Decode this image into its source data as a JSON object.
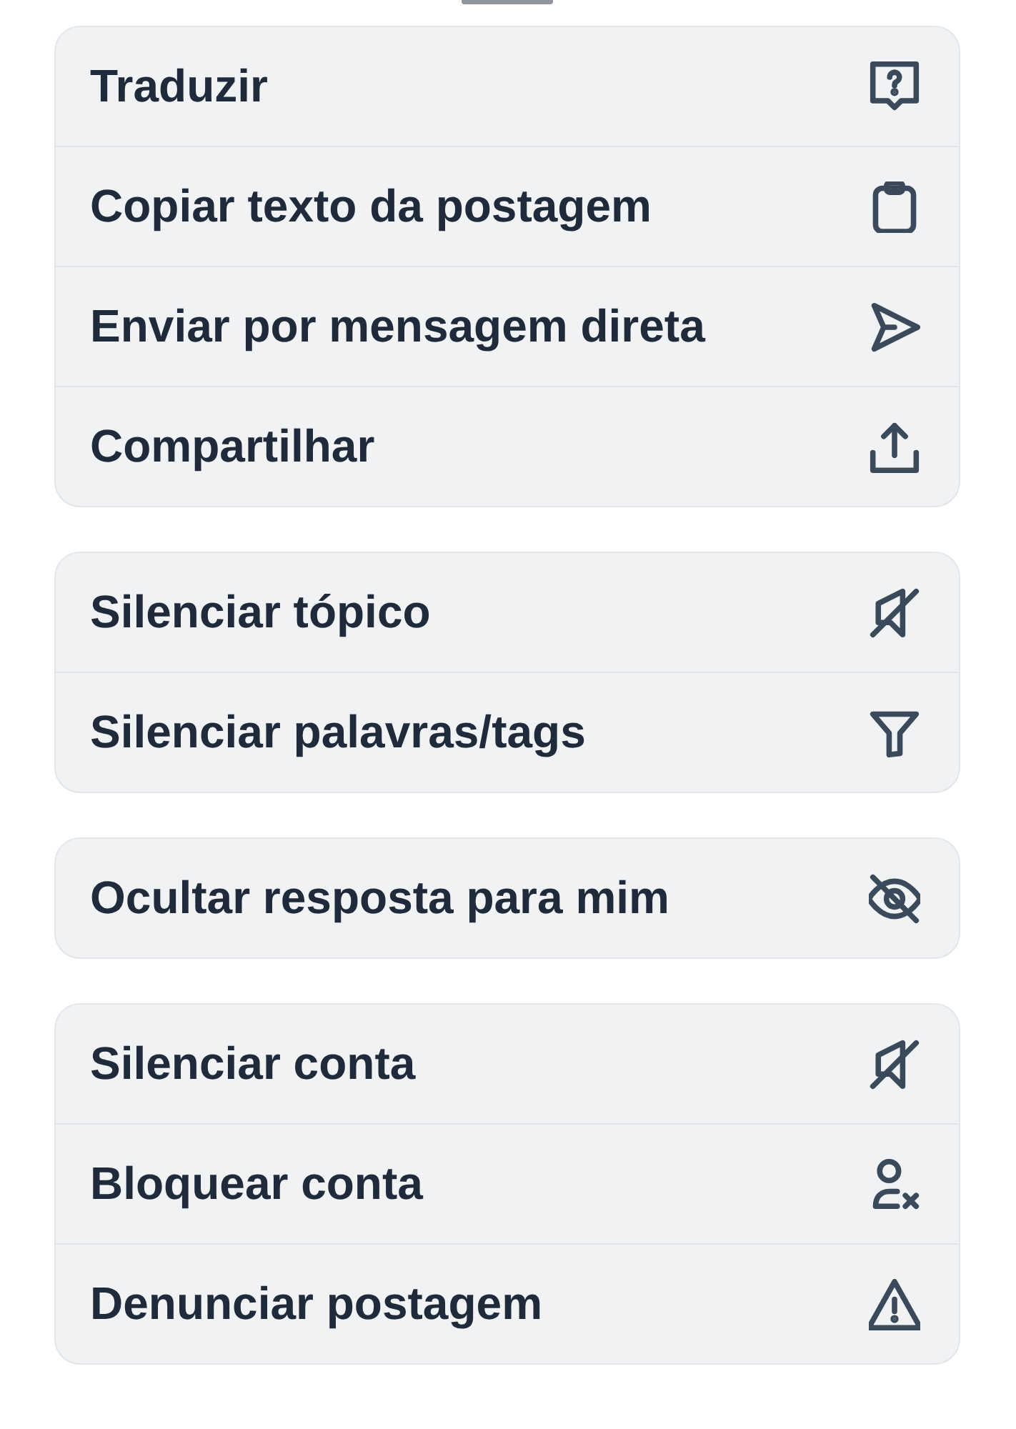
{
  "action_sheet": {
    "groups": [
      {
        "items": [
          {
            "label": "Traduzir"
          },
          {
            "label": "Copiar texto da postagem"
          },
          {
            "label": "Enviar por mensagem direta"
          },
          {
            "label": "Compartilhar"
          }
        ]
      },
      {
        "items": [
          {
            "label": "Silenciar tópico"
          },
          {
            "label": "Silenciar palavras/tags"
          }
        ]
      },
      {
        "items": [
          {
            "label": "Ocultar resposta para mim"
          }
        ]
      },
      {
        "items": [
          {
            "label": "Silenciar conta"
          },
          {
            "label": "Bloquear conta"
          },
          {
            "label": "Denunciar postagem"
          }
        ]
      }
    ]
  }
}
